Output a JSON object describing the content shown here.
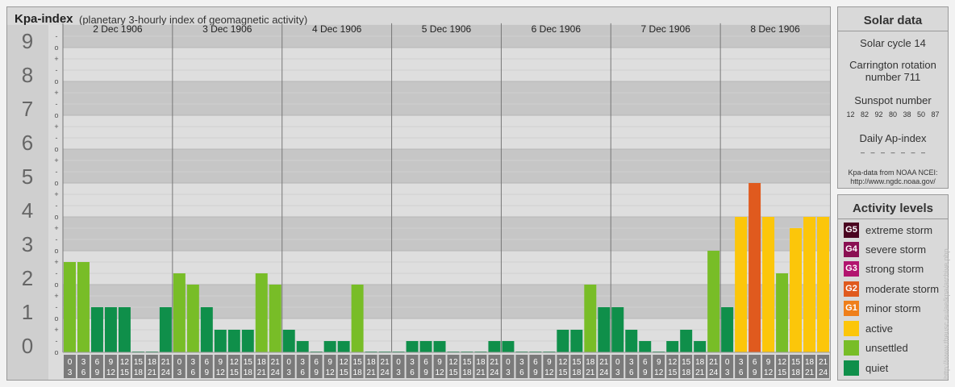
{
  "header": {
    "title": "Kpa-index",
    "subtitle": "(planetary 3-hourly index of geomagnetic activity)"
  },
  "chart_data": {
    "type": "bar",
    "y_ticks": [
      "0",
      "1",
      "2",
      "3",
      "4",
      "5",
      "6",
      "7",
      "8",
      "9"
    ],
    "sub_ticks": [
      "-",
      "o",
      "+"
    ],
    "days": [
      "2 Dec 1906",
      "3 Dec 1906",
      "4 Dec 1906",
      "5 Dec 1906",
      "6 Dec 1906",
      "7 Dec 1906",
      "8 Dec 1906"
    ],
    "hour_labels": [
      [
        "0",
        "3"
      ],
      [
        "3",
        "6"
      ],
      [
        "6",
        "9"
      ],
      [
        "9",
        "12"
      ],
      [
        "12",
        "15"
      ],
      [
        "15",
        "18"
      ],
      [
        "18",
        "21"
      ],
      [
        "21",
        "24"
      ]
    ],
    "ylim": [
      0,
      9.67
    ],
    "values": [
      [
        2.667,
        2.667,
        1.333,
        1.333,
        1.333,
        0,
        0,
        1.333
      ],
      [
        2.333,
        2.0,
        1.333,
        0.667,
        0.667,
        0.667,
        2.333,
        2.0
      ],
      [
        0.667,
        0.333,
        0,
        0.333,
        0.333,
        2.0,
        0,
        0
      ],
      [
        0,
        0.333,
        0.333,
        0.333,
        0,
        0,
        0,
        0.333
      ],
      [
        0.333,
        0,
        0,
        0,
        0.667,
        0.667,
        2.0,
        1.333
      ],
      [
        1.333,
        0.667,
        0.333,
        0,
        0.333,
        0.667,
        0.333,
        3.0
      ],
      [
        1.333,
        4.0,
        5.0,
        4.0,
        2.333,
        3.667,
        4.0,
        4.0
      ]
    ],
    "level_colors": {
      "quiet": "#0f8f4a",
      "unsettled": "#78bd27",
      "active": "#fcc60a",
      "G1": "#ef7f1a",
      "G2": "#e05a1e",
      "G3": "#b2146f",
      "G4": "#8a0f52",
      "G5": "#4a0520"
    }
  },
  "solar": {
    "heading": "Solar data",
    "cycle": "Solar cycle 14",
    "carrington_1": "Carrington rotation",
    "carrington_2": "number 711",
    "sunspot_label": "Sunspot number",
    "sunspots": "12 82 92 80 38 50 87",
    "ap_label": "Daily Ap-index",
    "ap_values": "– – – – – – –",
    "source_1": "Kpa-data from NOAA NCEI:",
    "source_2": "http://www.ngdc.noaa.gov/"
  },
  "activity": {
    "heading": "Activity levels",
    "levels": [
      {
        "code": "G5",
        "label": "extreme storm",
        "color": "#4a0520"
      },
      {
        "code": "G4",
        "label": "severe storm",
        "color": "#8a0f52"
      },
      {
        "code": "G3",
        "label": "strong storm",
        "color": "#b2146f"
      },
      {
        "code": "G2",
        "label": "moderate storm",
        "color": "#e05a1e"
      },
      {
        "code": "G1",
        "label": "minor storm",
        "color": "#ef7f1a"
      },
      {
        "code": "",
        "label": "active",
        "color": "#fcc60a"
      },
      {
        "code": "",
        "label": "unsettled",
        "color": "#78bd27"
      },
      {
        "code": "",
        "label": "quiet",
        "color": "#0f8f4a"
      }
    ]
  },
  "credit": "http://www.theusc.eu/ae/kpa/archive.php"
}
